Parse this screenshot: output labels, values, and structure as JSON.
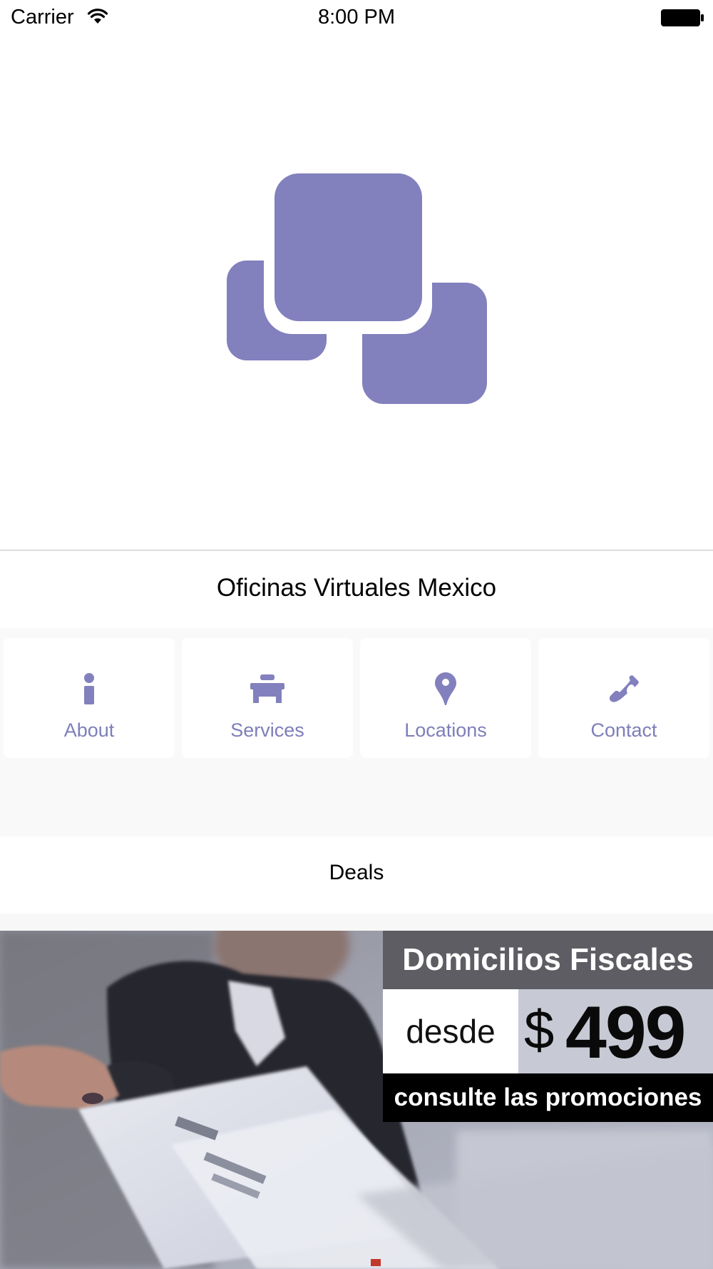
{
  "status_bar": {
    "carrier": "Carrier",
    "time": "8:00 PM"
  },
  "app": {
    "title": "Oficinas Virtuales Mexico",
    "accent_color": "#8280bd",
    "logo_icon": "stacked-squares-logo"
  },
  "menu": {
    "items": [
      {
        "label": "About",
        "icon": "info-icon"
      },
      {
        "label": "Services",
        "icon": "desk-icon"
      },
      {
        "label": "Locations",
        "icon": "map-pin-icon"
      },
      {
        "label": "Contact",
        "icon": "phone-icon"
      }
    ]
  },
  "deals": {
    "title": "Deals",
    "banner": {
      "heading": "Domicilios Fiscales",
      "from_label": "desde",
      "currency": "$",
      "price": "499",
      "cta": "consulte las promociones"
    }
  }
}
